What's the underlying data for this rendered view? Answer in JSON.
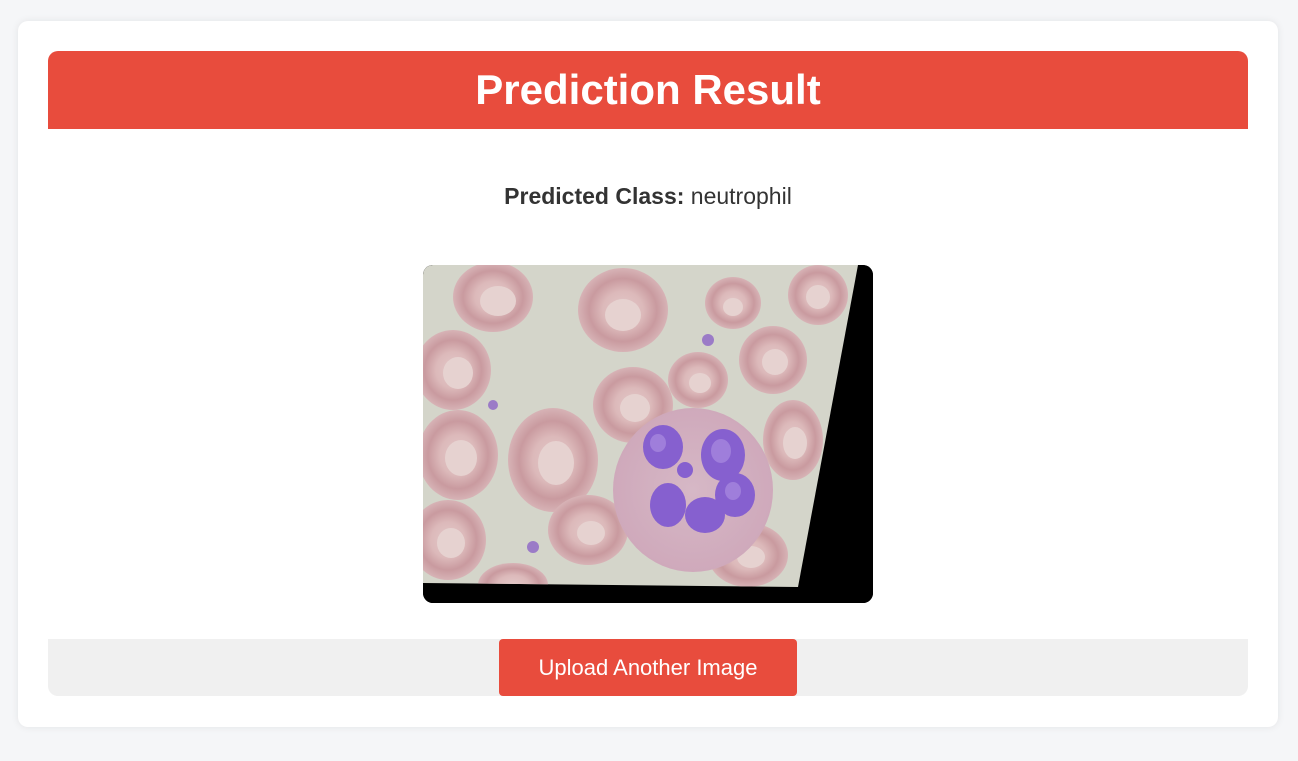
{
  "header": {
    "title": "Prediction Result"
  },
  "result": {
    "label": "Predicted Class:",
    "value": "neutrophil"
  },
  "image": {
    "subject": "blood-smear-cell-image"
  },
  "actions": {
    "upload_label": "Upload Another Image"
  },
  "colors": {
    "accent": "#e84c3d",
    "footer_bg": "#f0f0f0",
    "page_bg": "#f5f6f8"
  }
}
